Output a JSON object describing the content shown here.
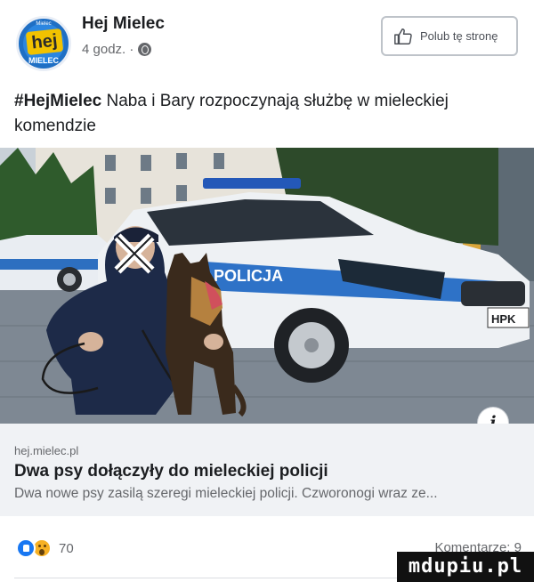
{
  "post": {
    "page_name": "Hej Mielec",
    "time": "4 godz. ·",
    "like_page_label": "Polub tę stronę",
    "avatar": {
      "top_text": "Mielec",
      "word": "hej",
      "bottom_text": "MIELEC"
    },
    "hashtag": "#HejMielec",
    "text": " Naba i Bary rozpoczynają służbę w mieleckiej komendzie"
  },
  "photo": {
    "car_text": "POLICJA",
    "plate": "HPK"
  },
  "link": {
    "domain": "hej.mielec.pl",
    "title": "Dwa psy dołączyły do mieleckiej policji",
    "description": "Dwa nowe psy zasilą szeregi mieleckiej policji. Czworonogi wraz ze...",
    "info_label": "i"
  },
  "footer": {
    "reaction_count": "70",
    "comments": "Komentarze: 9",
    "watermark": "mdupiu.pl"
  },
  "colors": {
    "facebook_blue": "#1877f2",
    "card_bg": "#f0f2f5",
    "secondary_text": "#65676b"
  }
}
